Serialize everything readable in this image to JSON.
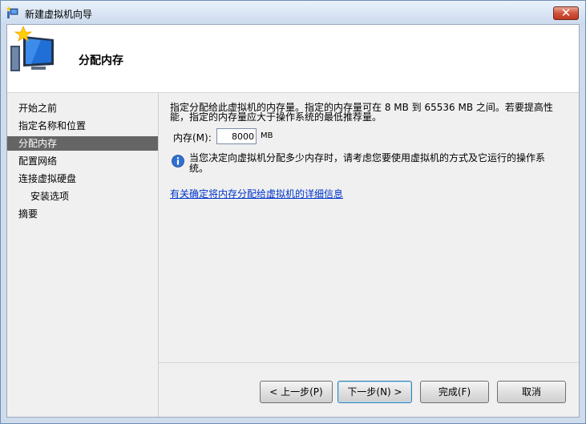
{
  "window": {
    "title": "新建虚拟机向导",
    "close_label": "✕"
  },
  "header": {
    "title": "分配内存"
  },
  "nav": {
    "items": [
      {
        "label": "开始之前"
      },
      {
        "label": "指定名称和位置"
      },
      {
        "label": "分配内存"
      },
      {
        "label": "配置网络"
      },
      {
        "label": "连接虚拟硬盘"
      },
      {
        "label": "安装选项"
      },
      {
        "label": "摘要"
      }
    ],
    "selected": "分配内存"
  },
  "content": {
    "description": "指定分配给此虚拟机的内存量。指定的内存量可在 8 MB 到 65536 MB 之间。若要提高性能，指定的内存量应大于操作系统的最低推荐量。",
    "memory_label": "内存(M):",
    "memory_value": "8000",
    "memory_unit": "MB",
    "info_text": "当您决定向虚拟机分配多少内存时，请考虑您要使用虚拟机的方式及它运行的操作系统。",
    "link_text": "有关确定将内存分配给虚拟机的详细信息"
  },
  "buttons": {
    "back": "< 上一步(P)",
    "next": "下一步(N) >",
    "finish": "完成(F)",
    "cancel": "取消"
  },
  "colors": {
    "nav_selected_bg": "#656565",
    "link": "#0033cc",
    "close_button": "#c0371f"
  },
  "icons": {
    "app": "wizard-computer-icon",
    "header": "new-computer-star-icon",
    "info": "info-icon",
    "close": "close-icon"
  }
}
